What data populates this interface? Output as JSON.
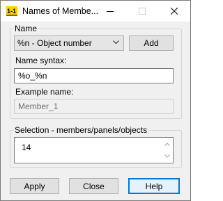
{
  "window": {
    "title": "Names of Membe...",
    "minimize_icon": "minimize-icon",
    "maximize_icon": "maximize-icon",
    "close_icon": "close-icon"
  },
  "name_group": {
    "label": "Name",
    "select_value": "%n - Object number",
    "add_label": "Add",
    "syntax_label": "Name syntax:",
    "syntax_value": "%o_%n",
    "example_label": "Example name:",
    "example_value": "Member_1"
  },
  "selection_group": {
    "label": "Selection - members/panels/objects",
    "value": "14"
  },
  "buttons": {
    "apply": "Apply",
    "close": "Close",
    "help": "Help"
  }
}
